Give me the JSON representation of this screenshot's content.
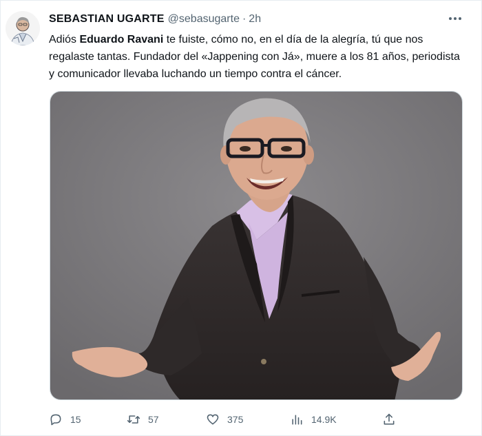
{
  "tweet": {
    "author_name": "SEBASTIAN UGARTE",
    "handle": "@sebasugarte",
    "separator": "·",
    "time": "2h",
    "text_part1": "Adiós ",
    "text_bold": "Eduardo Ravani",
    "text_part2": " te fuiste, cómo no, en el día de la alegría, tú que nos regalaste tantas. Fundador del «Jappening con Já», muere a los 81 años, periodista y comunicador llevaba luchando un tiempo contra el cáncer."
  },
  "actions": {
    "replies": "15",
    "retweets": "57",
    "likes": "375",
    "views": "14.9K"
  },
  "icons": {
    "more": "more-horizontal-icon",
    "reply": "comment-icon",
    "retweet": "retweet-icon",
    "like": "heart-icon",
    "views": "views-bar-chart-icon",
    "share": "share-upload-icon"
  },
  "colors": {
    "text": "#0f1419",
    "secondary": "#536471",
    "photo_background": "#7e7c7f",
    "jacket": "#2d2828",
    "shirt": "#d8c0e6"
  }
}
